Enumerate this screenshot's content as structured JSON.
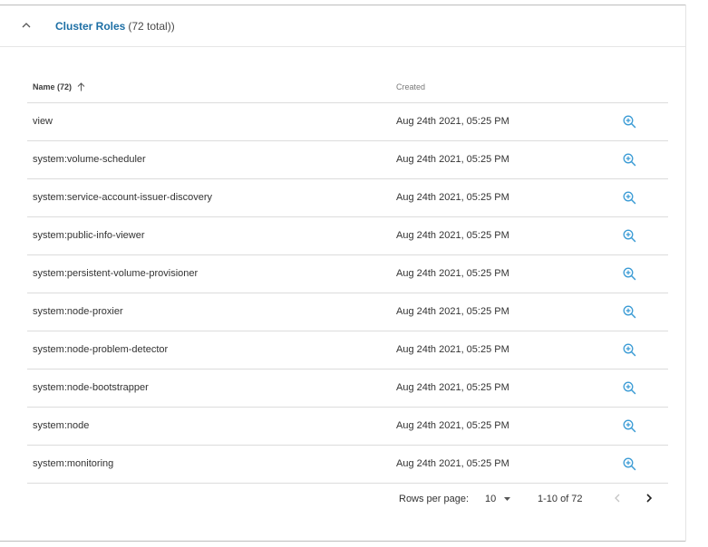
{
  "section": {
    "title": "Cluster Roles",
    "count_text": "(72 total))"
  },
  "table": {
    "headers": {
      "name": "Name (72)",
      "created": "Created"
    },
    "rows": [
      {
        "name": "view",
        "created": "Aug 24th 2021, 05:25 PM"
      },
      {
        "name": "system:volume-scheduler",
        "created": "Aug 24th 2021, 05:25 PM"
      },
      {
        "name": "system:service-account-issuer-discovery",
        "created": "Aug 24th 2021, 05:25 PM"
      },
      {
        "name": "system:public-info-viewer",
        "created": "Aug 24th 2021, 05:25 PM"
      },
      {
        "name": "system:persistent-volume-provisioner",
        "created": "Aug 24th 2021, 05:25 PM"
      },
      {
        "name": "system:node-proxier",
        "created": "Aug 24th 2021, 05:25 PM"
      },
      {
        "name": "system:node-problem-detector",
        "created": "Aug 24th 2021, 05:25 PM"
      },
      {
        "name": "system:node-bootstrapper",
        "created": "Aug 24th 2021, 05:25 PM"
      },
      {
        "name": "system:node",
        "created": "Aug 24th 2021, 05:25 PM"
      },
      {
        "name": "system:monitoring",
        "created": "Aug 24th 2021, 05:25 PM"
      }
    ]
  },
  "pagination": {
    "rows_per_page_label": "Rows per page:",
    "rows_per_page_value": "10",
    "range": "1-10 of 72"
  },
  "icons": {
    "collapse": "chevron-up-icon",
    "sort": "arrow-up-icon",
    "row_action": "zoom-in-icon",
    "dropdown": "caret-down-icon",
    "prev": "chevron-left-icon",
    "next": "chevron-right-icon"
  },
  "colors": {
    "accent": "#1d6fa5",
    "icon": "#3a9bd5",
    "divider": "#dcdcdc"
  }
}
